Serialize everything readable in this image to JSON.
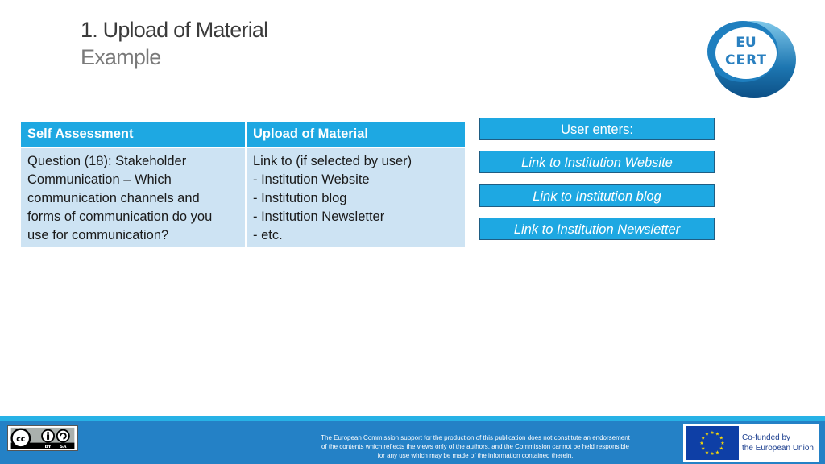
{
  "header": {
    "title": "1. Upload of Material",
    "subtitle": "Example",
    "logo": {
      "line1": "EU",
      "line2": "CERT"
    }
  },
  "table": {
    "headers": [
      "Self Assessment",
      "Upload of Material"
    ],
    "rows": [
      {
        "col1": [
          "Question (18): Stakeholder",
          "Communication – Which",
          "communication channels and",
          "forms of communication do you",
          "use for communication?"
        ],
        "col2": [
          "Link to (if selected by user)",
          "- Institution Website",
          "- Institution blog",
          "- Institution Newsletter",
          "- etc."
        ]
      }
    ]
  },
  "side_boxes": {
    "heading": "User enters:",
    "items": [
      "Link to Institution Website",
      "Link to Institution blog",
      "Link to Institution Newsletter"
    ]
  },
  "footer": {
    "license": {
      "cc": "cc",
      "by": "BY",
      "sa": "SA"
    },
    "disclaimer": [
      "The European Commission support for the production of this publication does not constitute an endorsement",
      "of the contents which reflects the views only of the authors, and the Commission cannot be held responsible",
      "for any use which may be made of the information contained therein."
    ],
    "eu_badge": {
      "line1": "Co-funded by",
      "line2": "the European Union"
    }
  },
  "colors": {
    "accent": "#1ea8e2",
    "table_body": "#cde3f3",
    "footer": "#2481c6",
    "eu_blue": "#0e3fa6"
  }
}
